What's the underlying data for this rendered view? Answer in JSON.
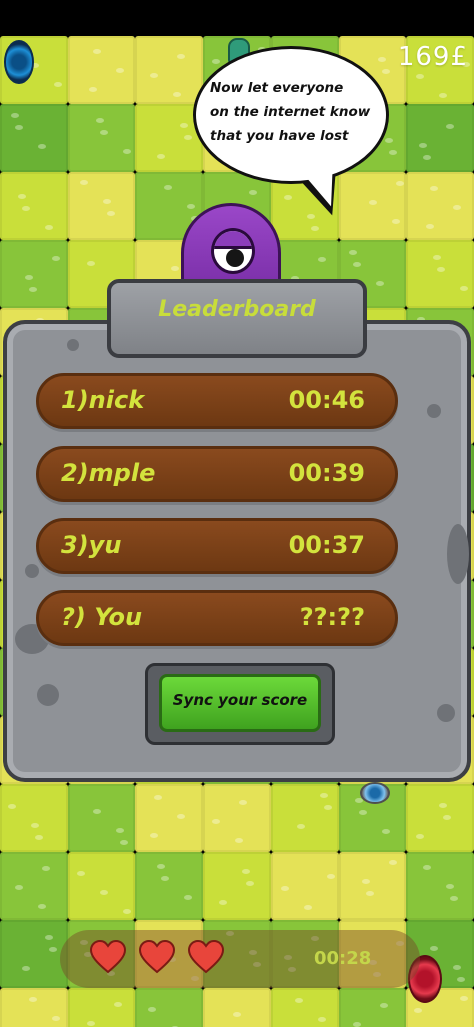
{
  "hud": {
    "coins": "169£",
    "timer": "00:28",
    "lives": 3
  },
  "speech_bubble": {
    "lines": [
      "Now let everyone",
      "on the internet know",
      "that you have lost"
    ]
  },
  "leaderboard": {
    "title": "Leaderboard",
    "entries": [
      {
        "name": "1)nick",
        "time": "00:46"
      },
      {
        "name": "2)mple",
        "time": "00:39"
      },
      {
        "name": "3)yu",
        "time": "00:37"
      },
      {
        "name": "?) You",
        "time": "??:??"
      }
    ],
    "sync_button": "Sync your score"
  },
  "colors": {
    "accent_text": "#d3e33d",
    "row_brown": "#7a3f16",
    "button_green": "#4fbf2a",
    "monster_purple": "#8a3dbb"
  },
  "icons": [
    "heart-icon",
    "portal-icon",
    "monster-character"
  ]
}
